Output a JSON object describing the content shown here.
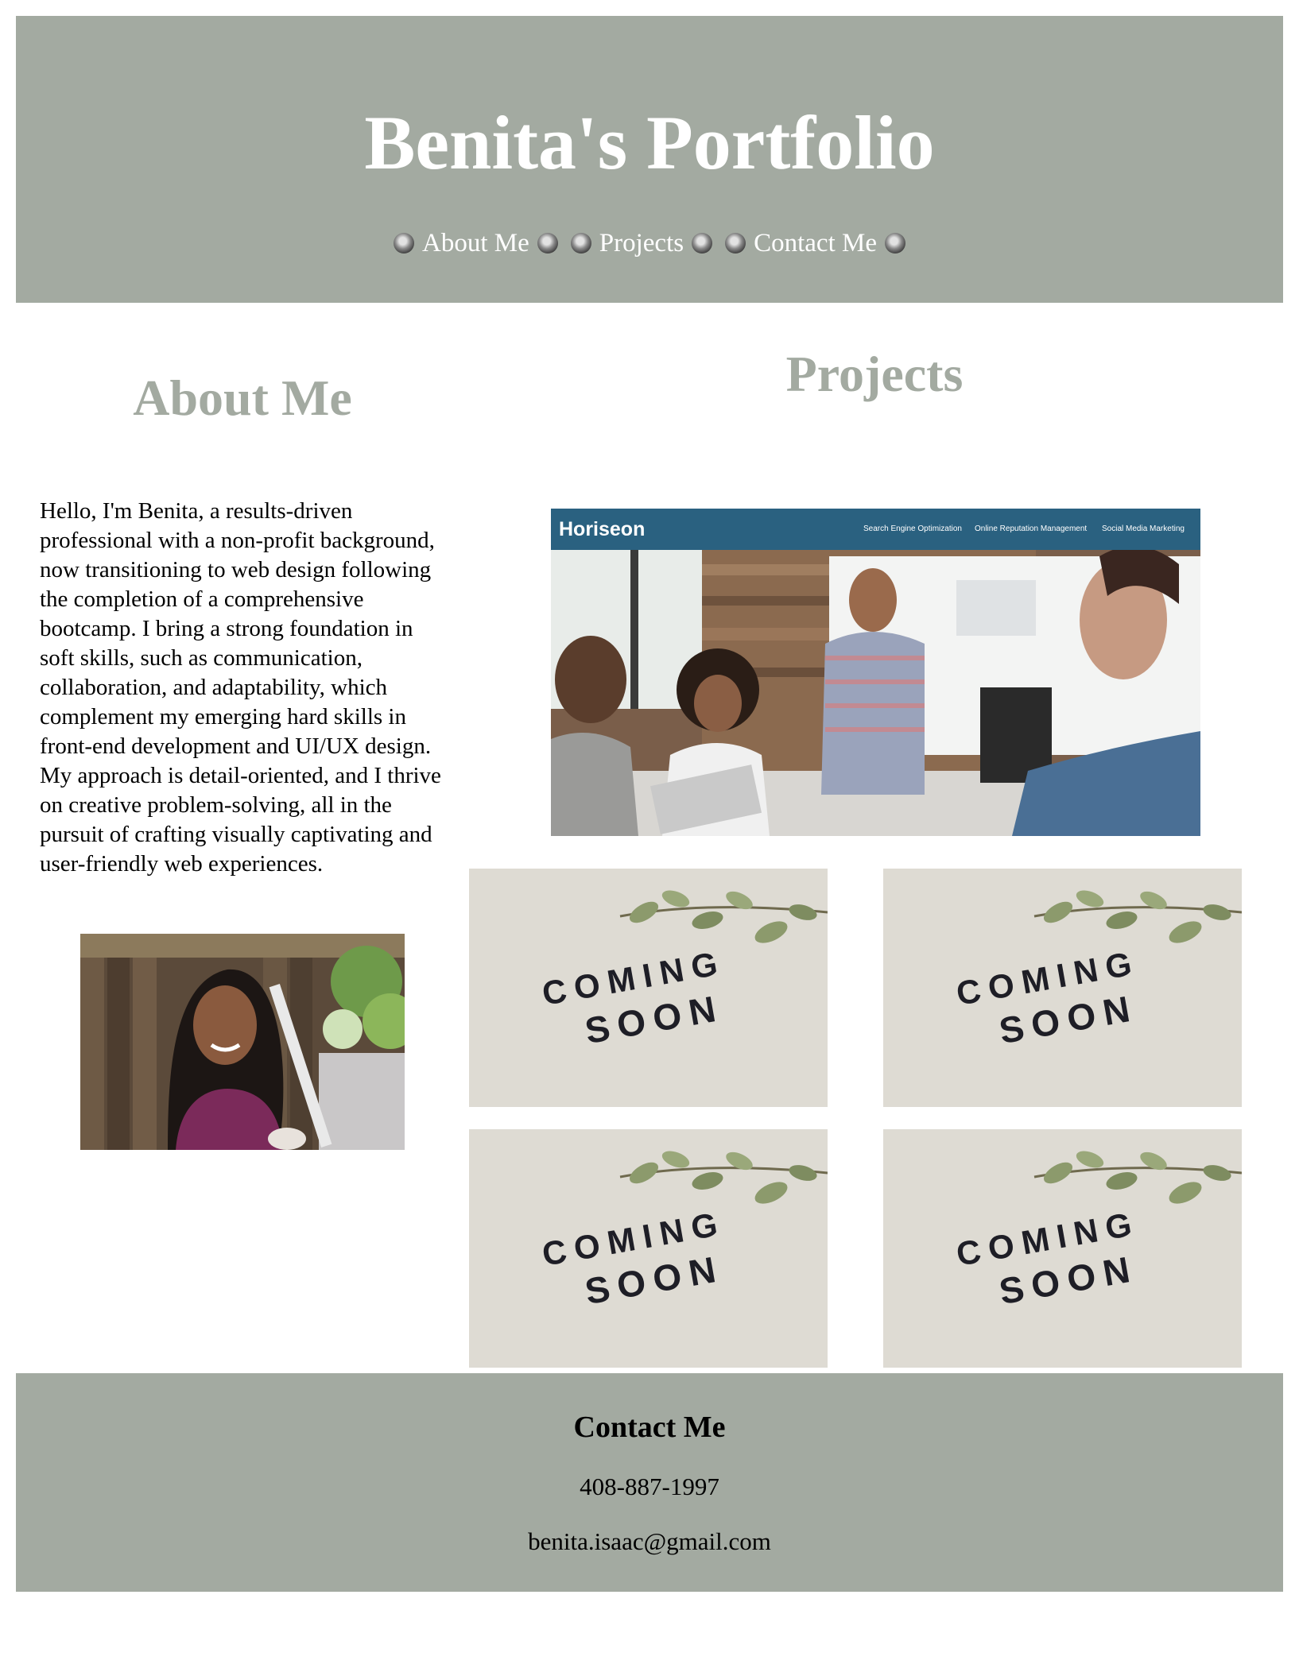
{
  "header": {
    "title": "Benita's Portfolio",
    "nav": [
      {
        "label": "About Me"
      },
      {
        "label": "Projects"
      },
      {
        "label": "Contact Me"
      }
    ]
  },
  "about": {
    "heading": "About Me",
    "text": "Hello, I'm Benita, a results-driven professional with a non-profit background, now transitioning to web design following the completion of a comprehensive bootcamp. I bring a strong foundation in soft skills, such as communication, collaboration, and adaptability, which complement my emerging hard skills in front-end development and UI/UX design. My approach is detail-oriented, and I thrive on creative problem-solving, all in the pursuit of crafting visually captivating and user-friendly web experiences."
  },
  "projects": {
    "heading": "Projects",
    "featured": {
      "brand": "Horiseon",
      "nav": [
        "Search Engine Optimization",
        "Online Reputation Management",
        "Social Media Marketing"
      ]
    },
    "placeholder_text": [
      "COMING",
      "SOON"
    ]
  },
  "footer": {
    "heading": "Contact Me",
    "phone": "408-887-1997",
    "email": "benita.isaac@gmail.com"
  },
  "colors": {
    "sage": "#a3aaa1",
    "horiseon_bar": "#2a6180",
    "placeholder_bg": "#dedbd3"
  }
}
